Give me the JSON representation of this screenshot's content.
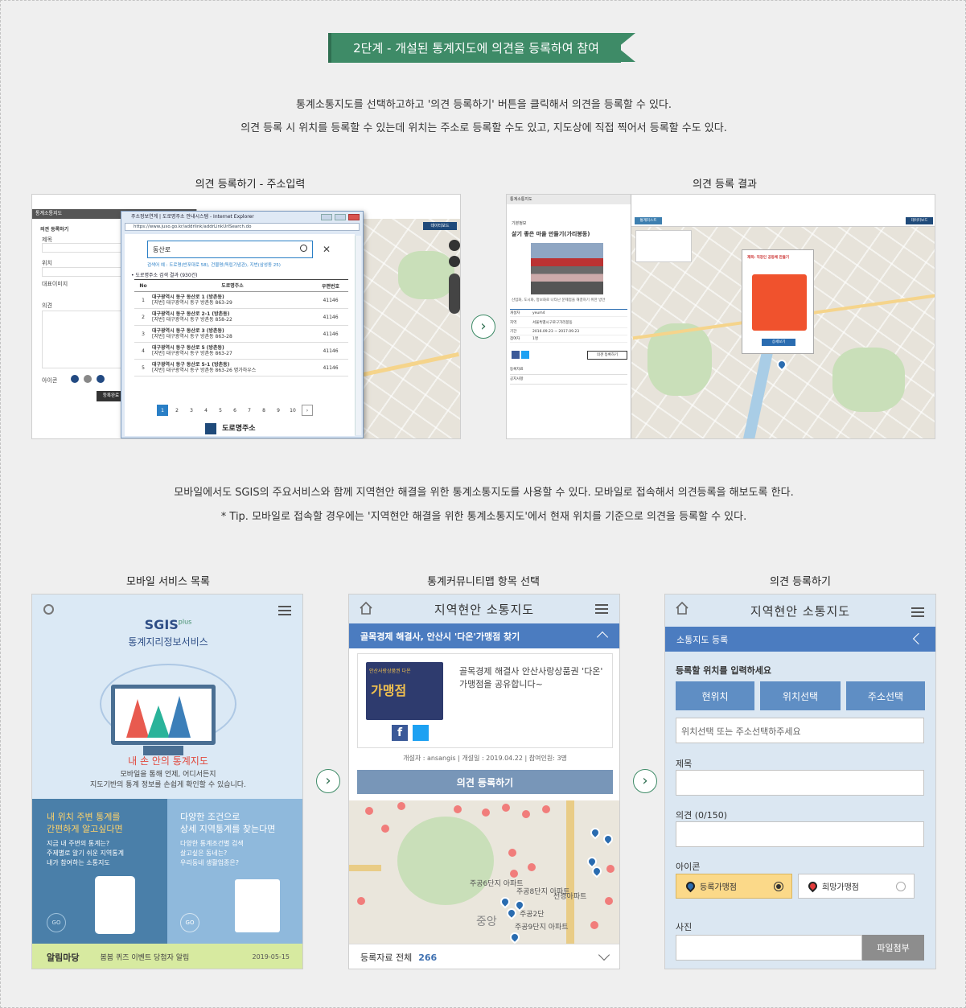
{
  "header": {
    "step_title": "2단계 - 개설된 통계지도에 의견을 등록하여 참여"
  },
  "intro": {
    "line1": "통계소통지도를 선택하고하고 '의견 등록하기' 버튼을 클릭해서 의견을 등록할 수 있다.",
    "line2": "의견 등록 시 위치를 등록할 수 있는데 위치는 주소로 등록할 수도 있고, 지도상에 직접 찍어서 등록할 수도 있다."
  },
  "captions": {
    "shot1": "의견 등록하기 - 주소입력",
    "shot2": "의견 등록 결과",
    "mobile1": "모바일 서비스 목록",
    "mobile2": "통계커뮤니티맵 항목 선택",
    "mobile3": "의견 등록하기"
  },
  "mobile_intro": {
    "line1": "모바일에서도 SGIS의 주요서비스와 함께 지역현안 해결을 위한 통계소통지도를 사용할 수 있다. 모바일로 접속해서 의견등록을 해보도록 한다.",
    "line2": "* Tip. 모바일로 접속할 경우에는 '지역현안 해결을 위한 통계소통지도'에서 현재 위치를 기준으로 의견을 등록할 수 있다."
  },
  "shot1": {
    "panel_header": "통계소통지도",
    "panel_title": "의견 등록하기",
    "field_title": "제목",
    "field_location": "위치",
    "field_image": "대표이미지",
    "field_opinion": "의견",
    "field_icon": "아이콘",
    "register_btn": "등록완료",
    "ie_title": "주소정보연계 | 도로명주소 안내시스템 - Internet Explorer",
    "ie_url": "https://www.juso.go.kr/addrlink/addrLinkUrlSearch.do",
    "search_value": "동산로",
    "search_example": "검색어 예 : 도로명(반포대로 58), 건물명(독립기념관), 지번(삼성동 25)",
    "result_count": "• 도로명주소 검색 결과 (930건)",
    "table_headers": [
      "No",
      "도로명주소",
      "우편번호"
    ],
    "rows": [
      {
        "no": "1",
        "road": "대구광역시 동구 동산로 1 (방촌동)",
        "jibun": "[지번] 대구광역시 동구 방촌동 863-29",
        "zip": "41146"
      },
      {
        "no": "2",
        "road": "대구광역시 동구 동산로 2-1 (방촌동)",
        "jibun": "[지번] 대구광역시 동구 방촌동 858-22",
        "zip": "41146"
      },
      {
        "no": "3",
        "road": "대구광역시 동구 동산로 3 (방촌동)",
        "jibun": "[지번] 대구광역시 동구 방촌동 863-28",
        "zip": "41146"
      },
      {
        "no": "4",
        "road": "대구광역시 동구 동산로 5 (방촌동)",
        "jibun": "[지번] 대구광역시 동구 방촌동 863-27",
        "zip": "41146"
      },
      {
        "no": "5",
        "road": "대구광역시 동구 동산로 5-1 (방촌동)",
        "jibun": "[지번] 대구광역시 동구 방촌동 863-26 명가하우스",
        "zip": "41146"
      }
    ],
    "pages": [
      "1",
      "2",
      "3",
      "4",
      "5",
      "6",
      "7",
      "8",
      "9",
      "10",
      "›"
    ],
    "footer_logo": "도로명주소",
    "dashboard_btn": "데이터보드"
  },
  "shot2": {
    "panel_header": "통계소통지도",
    "section": "기본정보",
    "map_title": "살기 좋은 마을 만들기(가리봉동)",
    "desc": "산업화, 도시화, 정보화로 나타난 문제점을 해결하기 위한 방안",
    "info": [
      {
        "k": "개설자",
        "v": "yeum4"
      },
      {
        "k": "지역",
        "v": "서울특별시구로구가리봉동"
      },
      {
        "k": "기간",
        "v": "2016.09.23 ~ 2017.09.23"
      },
      {
        "k": "참여자",
        "v": "1명"
      }
    ],
    "register_btn": "의견 등록하기",
    "stats": "등록자료",
    "notice": "공지사항",
    "popup_title": "제목: 직장인 공동체 만들기",
    "popup_btn": "상세보기",
    "map_tab": "통계리스트",
    "dashboard_btn": "데이터보드"
  },
  "mobile1": {
    "brand": "SGIS",
    "brand_sub": "plus",
    "service_name": "통계지리정보서비스",
    "slogan": "내 손 안의 통계지도",
    "slogan_desc1": "모바일을 통해 언제, 어디서든지",
    "slogan_desc2": "지도기반의 통계 정보를 손쉽게 확인할 수 있습니다.",
    "card_left_title1": "내 위치 주변 통계를",
    "card_left_title2": "간편하게 알고싶다면",
    "card_left_desc1": "지금 내 주변의 통계는?",
    "card_left_desc2": "주제별로 알기 쉬운 지역통계",
    "card_left_desc3": "내가 참여하는 소통지도",
    "card_right_title1": "다양한 조건으로",
    "card_right_title2": "상세 지역통계를 찾는다면",
    "card_right_desc1": "다양한 통계조건별 검색",
    "card_right_desc2": "살고싶은 동네는?",
    "card_right_desc3": "우리동네 생활업종은?",
    "go": "GO",
    "notice_label": "알림마당",
    "notice_text": "봄봄 퀴즈 이벤트 당첨자 알림",
    "notice_date": "2019-05-15"
  },
  "mobile2": {
    "title": "지역현안 소통지도",
    "topic": "골목경제 해결사, 안산시 '다온'가맹점 찾기",
    "card_text": "골목경제 해결사 안산사랑상품권 '다온' 가맹점을 공유합니다~",
    "card_img_top": "안산사랑상품권 다온",
    "card_img_main": "가맹점",
    "meta": "개설자 : ansangis  |  개설일 : 2019.04.22  |  참여인원: 3명",
    "register_btn": "의견 등록하기",
    "footer_label": "등록자료 전체",
    "footer_count": "266",
    "map_labels": [
      "주공6단지 아파트",
      "주공8단지 아파트",
      "선경아파트",
      "주공9단지 아파트",
      "주공2단",
      "중앙"
    ]
  },
  "mobile3": {
    "title": "지역현안 소통지도",
    "bar": "소통지도 등록",
    "loc_label": "등록할 위치를 입력하세요",
    "btn_current": "현위치",
    "btn_select": "위치선택",
    "btn_address": "주소선택",
    "loc_placeholder": "위치선택 또는 주소선택하주세요",
    "title_label": "제목",
    "opinion_label": "의견 (0/150)",
    "icon_label": "아이콘",
    "icon_opt1": "등록가맹점",
    "icon_opt2": "희망가맹점",
    "photo_label": "사진",
    "attach_btn": "파일첨부"
  },
  "colors": {
    "ribbon": "#3e8b67",
    "mobile_blue": "#4b7cc0",
    "mobile_btn": "#5f8ec4"
  }
}
